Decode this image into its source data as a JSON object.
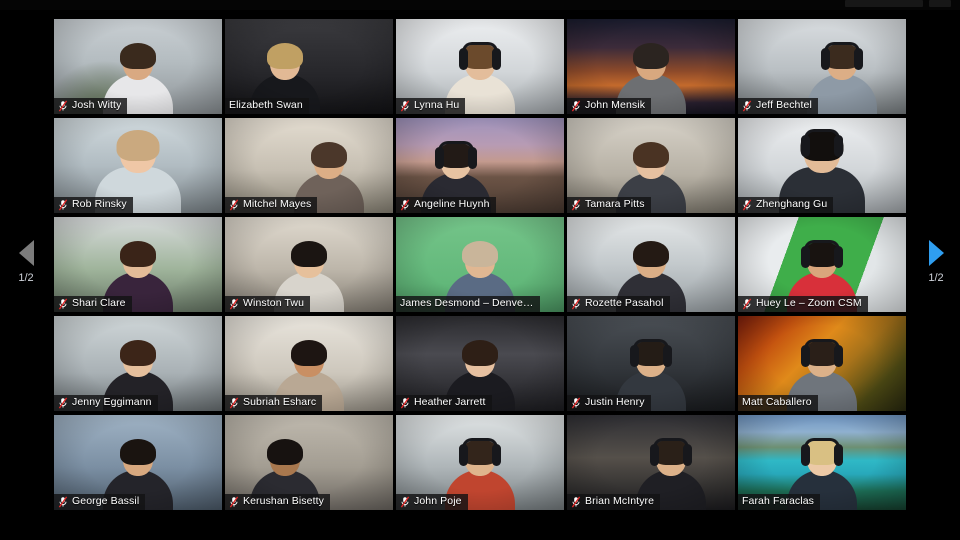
{
  "app": {
    "name": "Zoom Gallery View",
    "background_color": "#000000",
    "active_speaker_border_color": "#c8e65a",
    "label_background_color": "#121214",
    "label_text_color": "#ffffff",
    "muted_mic_color": "#e02b2b"
  },
  "navigation": {
    "prev": {
      "icon": "triangle-left-icon",
      "page_label": "1/2",
      "enabled": false,
      "color": "#7c7c7c"
    },
    "next": {
      "icon": "triangle-right-icon",
      "page_label": "1/2",
      "enabled": true,
      "color": "#2f9ef0"
    }
  },
  "grid": {
    "columns": 5,
    "rows": 5,
    "total_tiles": 25
  },
  "participants": [
    {
      "name": "Josh Witty",
      "muted": true,
      "active": false,
      "bg": "bg-office1",
      "skin": "#d9a982",
      "hair": "#3a2a1d",
      "shirt": "#e7e7e9",
      "headset": false,
      "pose": "center"
    },
    {
      "name": "Elizabeth Swan",
      "muted": false,
      "active": false,
      "bg": "bg-darkroom",
      "skin": "#e2b995",
      "hair": "#c0a063",
      "shirt": "#17181c",
      "headset": false,
      "pose": "off-l"
    },
    {
      "name": "Lynna Hu",
      "muted": true,
      "active": false,
      "bg": "bg-whiteoff",
      "skin": "#e3bd9b",
      "hair": "#6b4a2c",
      "shirt": "#e9e2d6",
      "headset": true,
      "pose": "center"
    },
    {
      "name": "John Mensik",
      "muted": true,
      "active": false,
      "bg": "bg-ggsunset",
      "skin": "#d8a87f",
      "hair": "#2b2420",
      "shirt": "#6d6f72",
      "headset": false,
      "pose": "center"
    },
    {
      "name": "Jeff Bechtel",
      "muted": true,
      "active": false,
      "bg": "bg-office2",
      "skin": "#dcae86",
      "hair": "#3b2b1e",
      "shirt": "#8e9aa6",
      "headset": true,
      "pose": "off-r"
    },
    {
      "name": "Rob Rinsky",
      "muted": true,
      "active": false,
      "bg": "bg-baby",
      "skin": "#efc7a6",
      "hair": "#caa97f",
      "shirt": "#cfd8dc",
      "headset": false,
      "pose": "big"
    },
    {
      "name": "Mitchel Mayes",
      "muted": true,
      "active": false,
      "bg": "bg-beige",
      "skin": "#dcae86",
      "hair": "#4b372a",
      "shirt": "#6f625a",
      "headset": false,
      "pose": "off-r"
    },
    {
      "name": "Angeline Huynh",
      "muted": true,
      "active": false,
      "bg": "bg-ggbeach",
      "skin": "#e7c3a2",
      "hair": "#221a16",
      "shirt": "#2a2a32",
      "headset": true,
      "pose": "off-l"
    },
    {
      "name": "Tamara Pitts",
      "muted": true,
      "active": false,
      "bg": "bg-room",
      "skin": "#e6c0a0",
      "hair": "#4a3323",
      "shirt": "#3c3f46",
      "headset": false,
      "pose": "center"
    },
    {
      "name": "Zhenghang Gu",
      "muted": true,
      "active": false,
      "bg": "bg-whiteoff",
      "skin": "#e2bb97",
      "hair": "#120f0d",
      "shirt": "#2b2f36",
      "headset": true,
      "pose": "big"
    },
    {
      "name": "Shari Clare",
      "muted": true,
      "active": false,
      "bg": "bg-plant",
      "skin": "#e3bb98",
      "hair": "#3a2418",
      "shirt": "#39243c",
      "headset": false,
      "pose": "center"
    },
    {
      "name": "Winston Twu",
      "muted": true,
      "active": false,
      "bg": "bg-kitchen",
      "skin": "#e6c09b",
      "hair": "#1b1512",
      "shirt": "#d8d4cc",
      "headset": false,
      "pose": "center"
    },
    {
      "name": "James Desmond – Denve…",
      "muted": false,
      "active": false,
      "bg": "bg-greenscr",
      "skin": "#e0b792",
      "hair": "#c9b59a",
      "shirt": "#5a6b84",
      "headset": false,
      "pose": "center"
    },
    {
      "name": "Rozette Pasahol",
      "muted": true,
      "active": false,
      "bg": "bg-office3",
      "skin": "#dbae86",
      "hair": "#241a14",
      "shirt": "#2f2f36",
      "headset": false,
      "pose": "center"
    },
    {
      "name": "Huey Le – Zoom CSM",
      "muted": true,
      "active": false,
      "bg": "bg-greenwall",
      "skin": "#d9a67c",
      "hair": "#181310",
      "shirt": "#d8303a",
      "headset": true,
      "pose": "center"
    },
    {
      "name": "Jenny Eggimann",
      "muted": true,
      "active": false,
      "bg": "bg-office4",
      "skin": "#e5bf9c",
      "hair": "#3c2518",
      "shirt": "#232227",
      "headset": false,
      "pose": "center"
    },
    {
      "name": "Subriah Esharc",
      "muted": true,
      "active": false,
      "bg": "bg-homewall",
      "skin": "#c98f63",
      "hair": "#1d1512",
      "shirt": "#b9a894",
      "headset": false,
      "pose": "center"
    },
    {
      "name": "Heather Jarrett",
      "muted": true,
      "active": false,
      "bg": "bg-car",
      "skin": "#e6c0a0",
      "hair": "#2e1f16",
      "shirt": "#1b1b20",
      "headset": false,
      "pose": "center"
    },
    {
      "name": "Justin Henry",
      "muted": true,
      "active": false,
      "bg": "bg-studio",
      "skin": "#dcb189",
      "hair": "#241c16",
      "shirt": "#33383f",
      "headset": true,
      "pose": "center"
    },
    {
      "name": "Matt Caballero",
      "muted": false,
      "active": false,
      "bg": "bg-autumn",
      "skin": "#dcb189",
      "hair": "#2a1f18",
      "shirt": "#6f757c",
      "headset": true,
      "pose": "center"
    },
    {
      "name": "George Bassil",
      "muted": true,
      "active": false,
      "bg": "bg-blueroom",
      "skin": "#d7a87f",
      "hair": "#1a1410",
      "shirt": "#24242a",
      "headset": false,
      "pose": "center"
    },
    {
      "name": "Kerushan Bisetty",
      "muted": true,
      "active": false,
      "bg": "bg-couch",
      "skin": "#a9784e",
      "hair": "#171210",
      "shirt": "#2b2b31",
      "headset": false,
      "pose": "off-l"
    },
    {
      "name": "John Poje",
      "muted": true,
      "active": false,
      "bg": "bg-office5",
      "skin": "#dfb58d",
      "hair": "#33251b",
      "shirt": "#c0452f",
      "headset": true,
      "pose": "center"
    },
    {
      "name": "Brian McIntyre",
      "muted": true,
      "active": false,
      "bg": "bg-lamp",
      "skin": "#dcb189",
      "hair": "#2a2018",
      "shirt": "#1f1f24",
      "headset": true,
      "pose": "off-r"
    },
    {
      "name": "Farah Faraclas",
      "muted": false,
      "active": true,
      "bg": "bg-banff",
      "skin": "#ecc9a6",
      "hair": "#d9c083",
      "shirt": "#26303c",
      "headset": true,
      "pose": "center"
    }
  ]
}
